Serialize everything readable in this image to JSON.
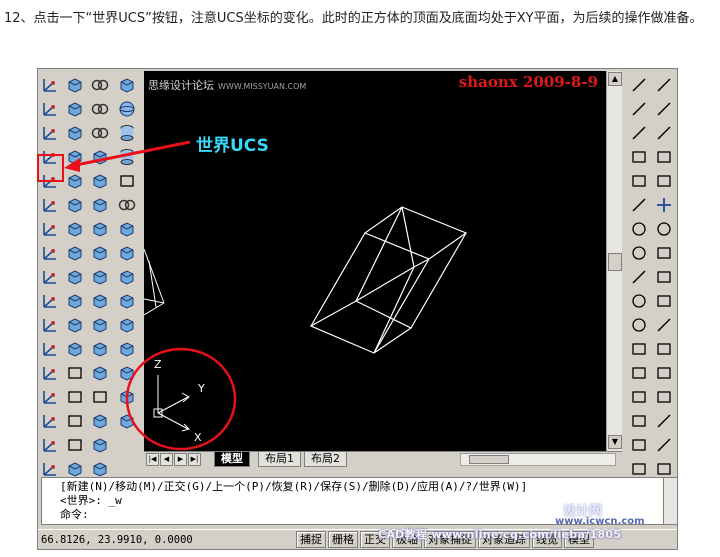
{
  "instruction": {
    "text": "12、点击一下“世界UCS”按钮，注意UCS坐标的变化。此时的正方体的顶面及底面均处于XY平面，为后续的操作做准备。"
  },
  "watermark": {
    "forum": "思缘设计论坛",
    "site": "WWW.MISSYUAN.COM",
    "author": "shaonx 2009-8-9",
    "bottom": "CAD教程 www.nline.cq.com/lieba/1805",
    "corner_a": "设计网",
    "corner_b": "www.icwcn.com"
  },
  "annotation": {
    "label": "世界UCS",
    "color": "#38d8f8",
    "marker_color": "#e8101a"
  },
  "ucs_icon": {
    "z": "Z",
    "y": "Y",
    "x": "X"
  },
  "tabs": [
    {
      "label": "模型",
      "active": true
    },
    {
      "label": "布局1",
      "active": false
    },
    {
      "label": "布局2",
      "active": false
    }
  ],
  "command": {
    "line1": "[新建(N)/移动(M)/正交(G)/上一个(P)/恢复(R)/保存(S)/删除(D)/应用(A)/?/世界(W)]",
    "line2": "<世界>: _w",
    "line3": "命令:"
  },
  "status": {
    "coords": "66.8126,  23.9910, 0.0000",
    "buttons": [
      "捕捉",
      "栅格",
      "正交",
      "极轴",
      "对象捕捉",
      "对象追踪",
      "线宽",
      "模型"
    ]
  },
  "icons": {
    "left_col1": [
      "ucs-icon",
      "ucs-icon",
      "ucs-icon",
      "world-ucs-icon",
      "ucs-icon",
      "ucs-icon",
      "ucs-icon",
      "ucs-icon",
      "ucs-icon",
      "ucs-icon",
      "ucs-icon",
      "ucs-icon",
      "ucs-icon",
      "ucs-icon",
      "ucs-icon",
      "ucs-icon",
      "ucs-icon",
      "ucs-icon"
    ],
    "right_col1": [
      "line-icon",
      "xline-icon",
      "pline-icon",
      "polygon-icon",
      "rectangle-icon",
      "arc-icon",
      "circle-icon",
      "cloud-icon",
      "spline-icon",
      "ellipse-icon",
      "ellipse-arc-icon",
      "block-icon",
      "make-block-icon",
      "point-icon",
      "hatch-icon",
      "region-icon",
      "text-icon"
    ]
  },
  "colors": {
    "canvas_bg": "#000000",
    "wire": "#ffffff",
    "ui_gray": "#d4d0c8"
  }
}
